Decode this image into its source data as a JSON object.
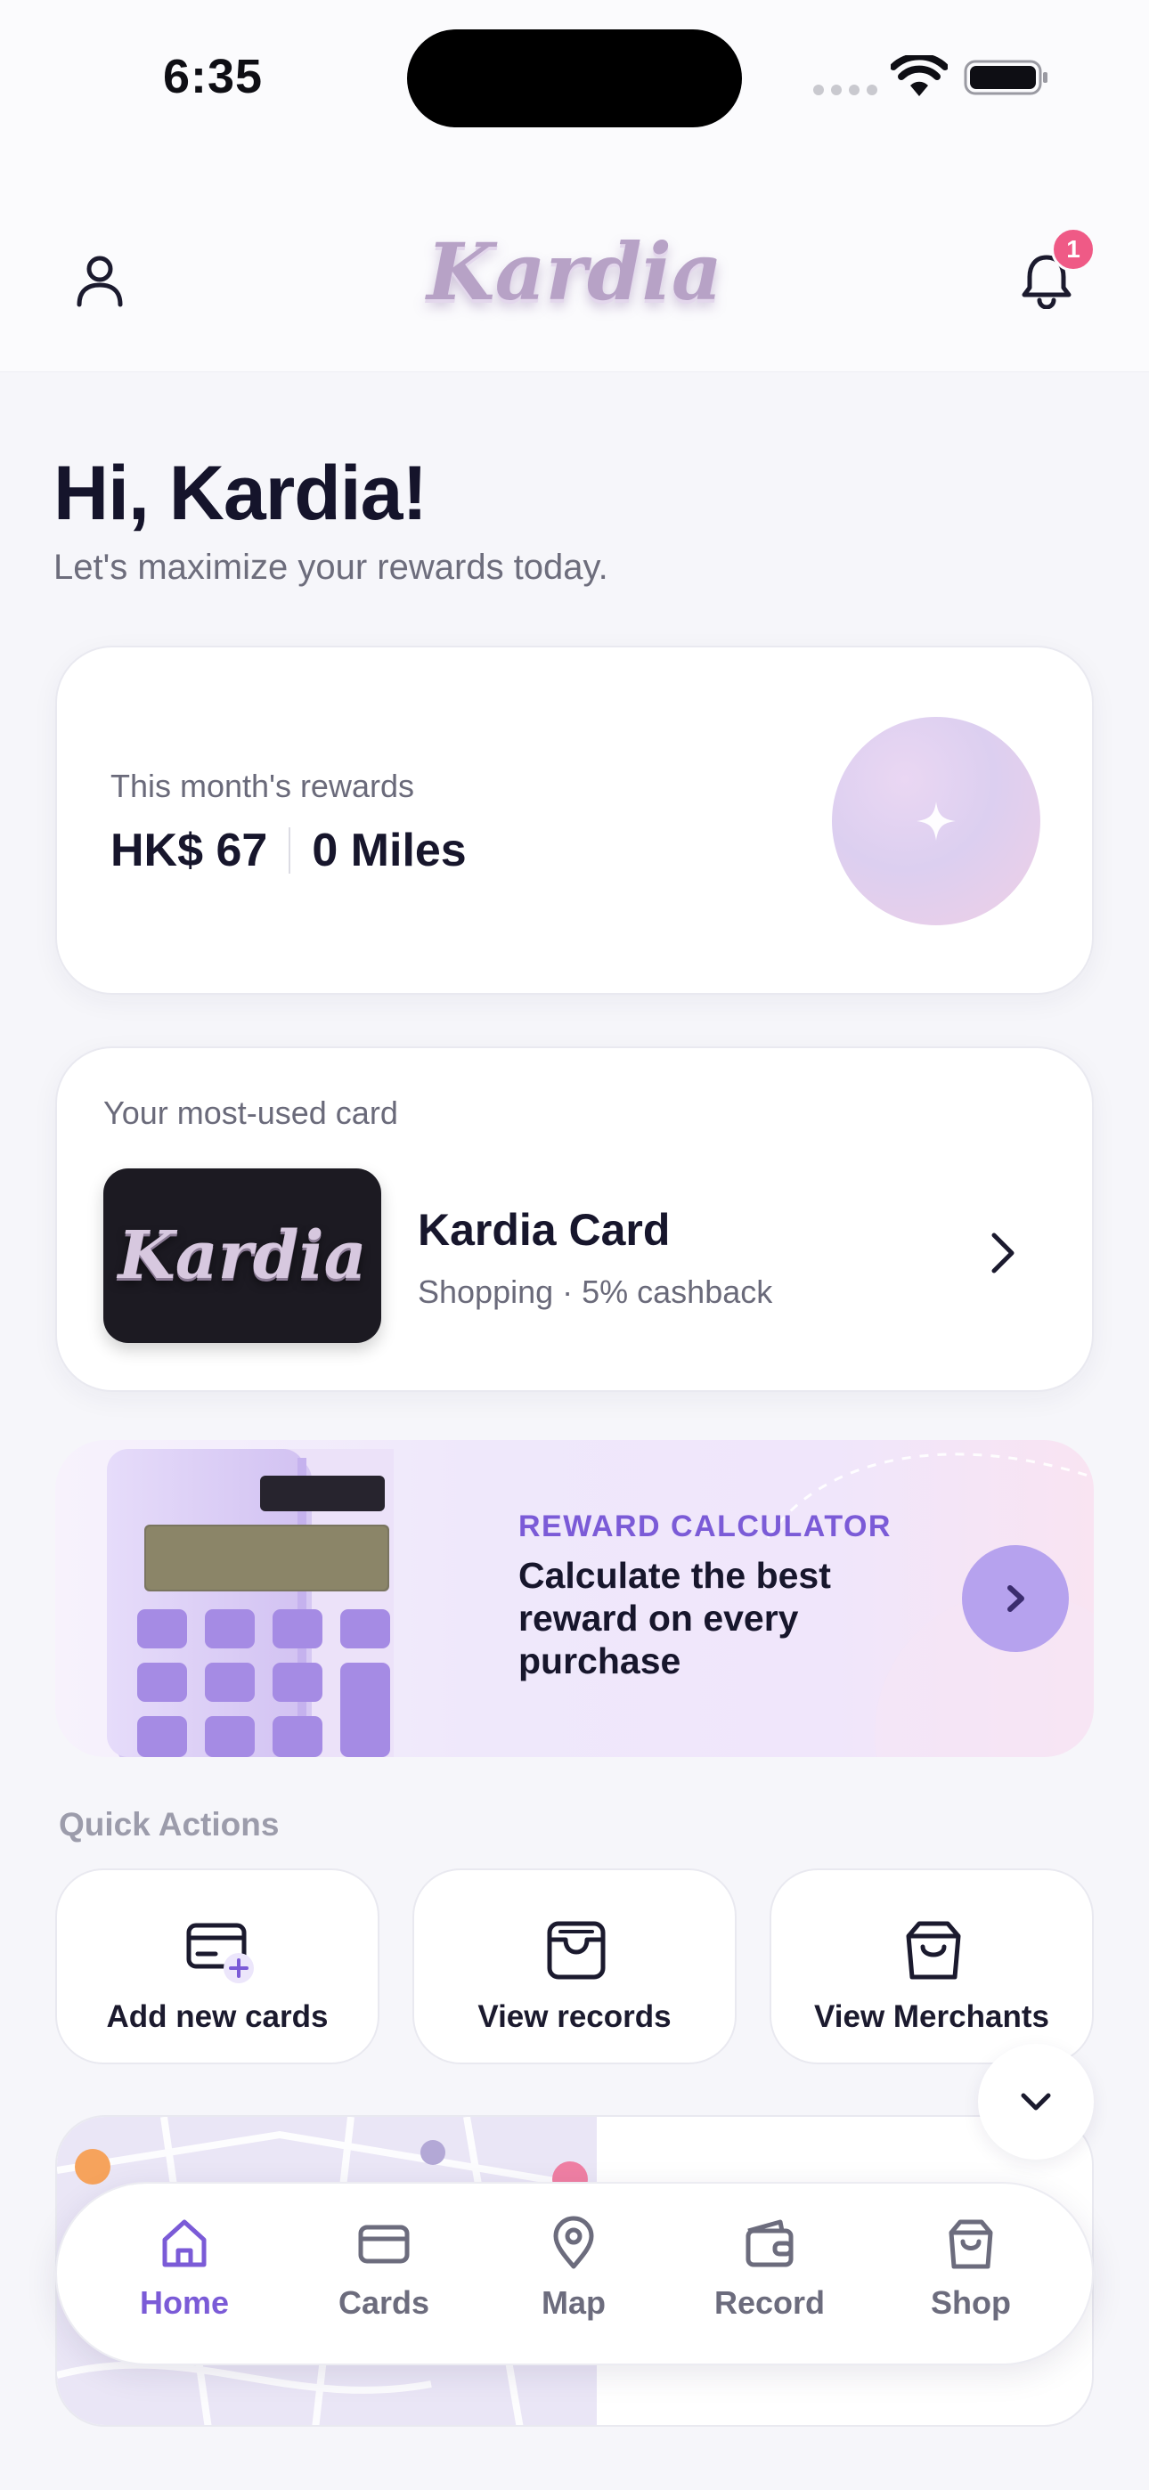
{
  "status_bar": {
    "time": "6:35"
  },
  "header": {
    "logo_text": "Kardia",
    "notification_count": "1"
  },
  "greeting": {
    "title": "Hi, Kardia!",
    "subtitle": "Let's maximize your rewards today."
  },
  "rewards": {
    "label": "This month's rewards",
    "cash": "HK$ 67",
    "miles": "0 Miles"
  },
  "most_used": {
    "label": "Your most-used card",
    "card_logo": "Kardia",
    "card_name": "Kardia Card",
    "card_desc": "Shopping · 5% cashback"
  },
  "calculator": {
    "kicker": "REWARD CALCULATOR",
    "title": "Calculate the best reward on every purchase"
  },
  "quick_actions": {
    "title": "Quick Actions",
    "items": [
      {
        "label": "Add new cards",
        "icon": "card-add-icon"
      },
      {
        "label": "View records",
        "icon": "archive-icon"
      },
      {
        "label": "View Merchants",
        "icon": "shopping-bag-icon"
      }
    ]
  },
  "tabs": [
    {
      "label": "Home",
      "icon": "home-icon",
      "active": true
    },
    {
      "label": "Cards",
      "icon": "card-icon",
      "active": false
    },
    {
      "label": "Map",
      "icon": "map-pin-icon",
      "active": false
    },
    {
      "label": "Record",
      "icon": "wallet-icon",
      "active": false
    },
    {
      "label": "Shop",
      "icon": "shopping-bag-icon",
      "active": false
    }
  ],
  "colors": {
    "accent": "#7b5bd7",
    "badge": "#ef5a86",
    "background": "#f6f6fa"
  }
}
